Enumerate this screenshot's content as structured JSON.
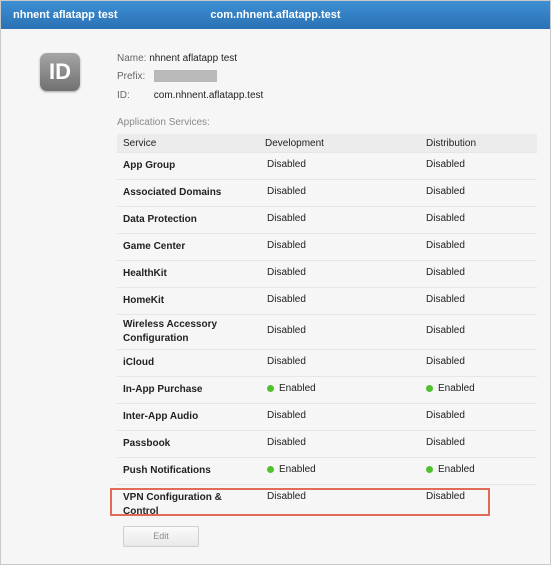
{
  "window": {
    "left_title": "nhnent aflatapp test",
    "center_title": "com.nhnent.aflatapp.test"
  },
  "app_id": {
    "icon_text": "ID",
    "name_label": "Name:",
    "name_value": "nhnent aflatapp test",
    "prefix_label": "Prefix:",
    "id_label": "ID:",
    "id_value": "com.nhnent.aflatapp.test"
  },
  "services": {
    "section_title": "Application Services:",
    "headers": {
      "service": "Service",
      "development": "Development",
      "distribution": "Distribution"
    },
    "rows": [
      {
        "service": "App Group",
        "development": "Disabled",
        "distribution": "Disabled"
      },
      {
        "service": "Associated Domains",
        "development": "Disabled",
        "distribution": "Disabled"
      },
      {
        "service": "Data Protection",
        "development": "Disabled",
        "distribution": "Disabled"
      },
      {
        "service": "Game Center",
        "development": "Disabled",
        "distribution": "Disabled"
      },
      {
        "service": "HealthKit",
        "development": "Disabled",
        "distribution": "Disabled"
      },
      {
        "service": "HomeKit",
        "development": "Disabled",
        "distribution": "Disabled"
      },
      {
        "service": "Wireless Accessory Configuration",
        "development": "Disabled",
        "distribution": "Disabled"
      },
      {
        "service": "iCloud",
        "development": "Disabled",
        "distribution": "Disabled"
      },
      {
        "service": "In-App Purchase",
        "development": "Enabled",
        "distribution": "Enabled"
      },
      {
        "service": "Inter-App Audio",
        "development": "Disabled",
        "distribution": "Disabled"
      },
      {
        "service": "Passbook",
        "development": "Disabled",
        "distribution": "Disabled"
      },
      {
        "service": "Push Notifications",
        "development": "Enabled",
        "distribution": "Enabled"
      },
      {
        "service": "VPN Configuration & Control",
        "development": "Disabled",
        "distribution": "Disabled"
      }
    ]
  },
  "edit_button": "Edit",
  "colors": {
    "titlebar": "#2a71b5",
    "enabled_dot": "#4fc12f",
    "highlight": "#e06b5b"
  }
}
